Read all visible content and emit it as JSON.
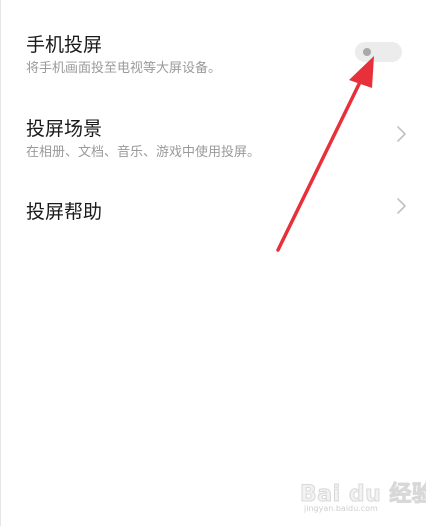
{
  "settings": {
    "items": [
      {
        "title": "手机投屏",
        "subtitle": "将手机画面投至电视等大屏设备。",
        "control": "toggle",
        "toggle_state": "off"
      },
      {
        "title": "投屏场景",
        "subtitle": "在相册、文档、音乐、游戏中使用投屏。",
        "control": "chevron"
      },
      {
        "title": "投屏帮助",
        "control": "chevron"
      }
    ]
  },
  "annotation": {
    "color": "#e8303a"
  },
  "watermark": {
    "brand": "Bai du 经验",
    "url": "jingyan.baidu.com"
  }
}
